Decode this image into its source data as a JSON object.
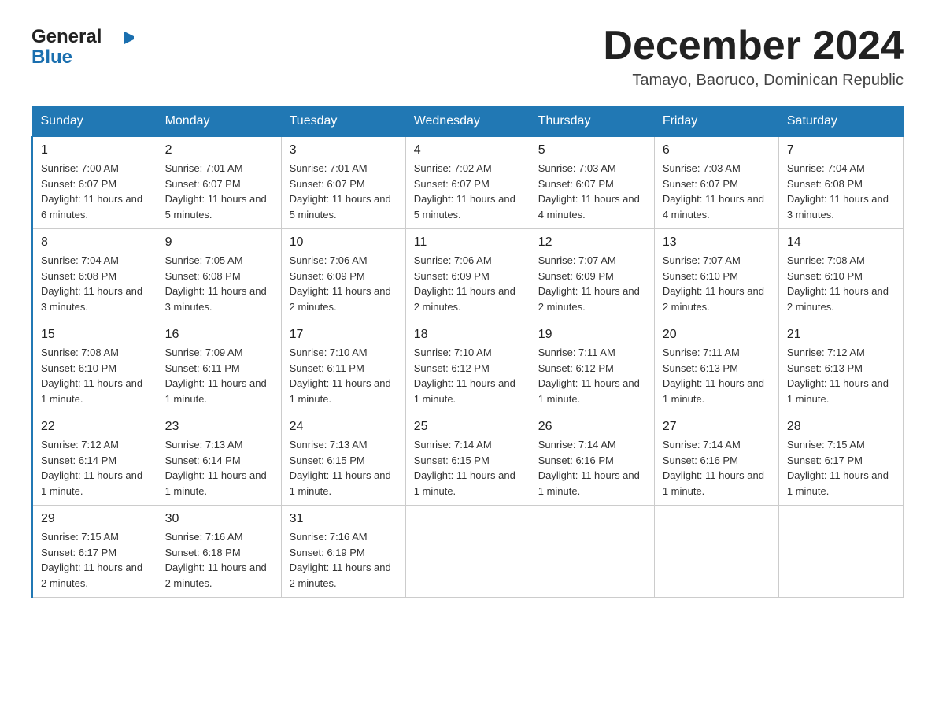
{
  "header": {
    "logo": {
      "text_general": "General",
      "text_blue": "Blue",
      "arrow_color": "#1a6faf"
    },
    "month_year": "December 2024",
    "location": "Tamayo, Baoruco, Dominican Republic"
  },
  "days_of_week": [
    "Sunday",
    "Monday",
    "Tuesday",
    "Wednesday",
    "Thursday",
    "Friday",
    "Saturday"
  ],
  "weeks": [
    [
      {
        "day": "1",
        "sunrise": "7:00 AM",
        "sunset": "6:07 PM",
        "daylight": "11 hours and 6 minutes."
      },
      {
        "day": "2",
        "sunrise": "7:01 AM",
        "sunset": "6:07 PM",
        "daylight": "11 hours and 5 minutes."
      },
      {
        "day": "3",
        "sunrise": "7:01 AM",
        "sunset": "6:07 PM",
        "daylight": "11 hours and 5 minutes."
      },
      {
        "day": "4",
        "sunrise": "7:02 AM",
        "sunset": "6:07 PM",
        "daylight": "11 hours and 5 minutes."
      },
      {
        "day": "5",
        "sunrise": "7:03 AM",
        "sunset": "6:07 PM",
        "daylight": "11 hours and 4 minutes."
      },
      {
        "day": "6",
        "sunrise": "7:03 AM",
        "sunset": "6:07 PM",
        "daylight": "11 hours and 4 minutes."
      },
      {
        "day": "7",
        "sunrise": "7:04 AM",
        "sunset": "6:08 PM",
        "daylight": "11 hours and 3 minutes."
      }
    ],
    [
      {
        "day": "8",
        "sunrise": "7:04 AM",
        "sunset": "6:08 PM",
        "daylight": "11 hours and 3 minutes."
      },
      {
        "day": "9",
        "sunrise": "7:05 AM",
        "sunset": "6:08 PM",
        "daylight": "11 hours and 3 minutes."
      },
      {
        "day": "10",
        "sunrise": "7:06 AM",
        "sunset": "6:09 PM",
        "daylight": "11 hours and 2 minutes."
      },
      {
        "day": "11",
        "sunrise": "7:06 AM",
        "sunset": "6:09 PM",
        "daylight": "11 hours and 2 minutes."
      },
      {
        "day": "12",
        "sunrise": "7:07 AM",
        "sunset": "6:09 PM",
        "daylight": "11 hours and 2 minutes."
      },
      {
        "day": "13",
        "sunrise": "7:07 AM",
        "sunset": "6:10 PM",
        "daylight": "11 hours and 2 minutes."
      },
      {
        "day": "14",
        "sunrise": "7:08 AM",
        "sunset": "6:10 PM",
        "daylight": "11 hours and 2 minutes."
      }
    ],
    [
      {
        "day": "15",
        "sunrise": "7:08 AM",
        "sunset": "6:10 PM",
        "daylight": "11 hours and 1 minute."
      },
      {
        "day": "16",
        "sunrise": "7:09 AM",
        "sunset": "6:11 PM",
        "daylight": "11 hours and 1 minute."
      },
      {
        "day": "17",
        "sunrise": "7:10 AM",
        "sunset": "6:11 PM",
        "daylight": "11 hours and 1 minute."
      },
      {
        "day": "18",
        "sunrise": "7:10 AM",
        "sunset": "6:12 PM",
        "daylight": "11 hours and 1 minute."
      },
      {
        "day": "19",
        "sunrise": "7:11 AM",
        "sunset": "6:12 PM",
        "daylight": "11 hours and 1 minute."
      },
      {
        "day": "20",
        "sunrise": "7:11 AM",
        "sunset": "6:13 PM",
        "daylight": "11 hours and 1 minute."
      },
      {
        "day": "21",
        "sunrise": "7:12 AM",
        "sunset": "6:13 PM",
        "daylight": "11 hours and 1 minute."
      }
    ],
    [
      {
        "day": "22",
        "sunrise": "7:12 AM",
        "sunset": "6:14 PM",
        "daylight": "11 hours and 1 minute."
      },
      {
        "day": "23",
        "sunrise": "7:13 AM",
        "sunset": "6:14 PM",
        "daylight": "11 hours and 1 minute."
      },
      {
        "day": "24",
        "sunrise": "7:13 AM",
        "sunset": "6:15 PM",
        "daylight": "11 hours and 1 minute."
      },
      {
        "day": "25",
        "sunrise": "7:14 AM",
        "sunset": "6:15 PM",
        "daylight": "11 hours and 1 minute."
      },
      {
        "day": "26",
        "sunrise": "7:14 AM",
        "sunset": "6:16 PM",
        "daylight": "11 hours and 1 minute."
      },
      {
        "day": "27",
        "sunrise": "7:14 AM",
        "sunset": "6:16 PM",
        "daylight": "11 hours and 1 minute."
      },
      {
        "day": "28",
        "sunrise": "7:15 AM",
        "sunset": "6:17 PM",
        "daylight": "11 hours and 1 minute."
      }
    ],
    [
      {
        "day": "29",
        "sunrise": "7:15 AM",
        "sunset": "6:17 PM",
        "daylight": "11 hours and 2 minutes."
      },
      {
        "day": "30",
        "sunrise": "7:16 AM",
        "sunset": "6:18 PM",
        "daylight": "11 hours and 2 minutes."
      },
      {
        "day": "31",
        "sunrise": "7:16 AM",
        "sunset": "6:19 PM",
        "daylight": "11 hours and 2 minutes."
      },
      null,
      null,
      null,
      null
    ]
  ]
}
